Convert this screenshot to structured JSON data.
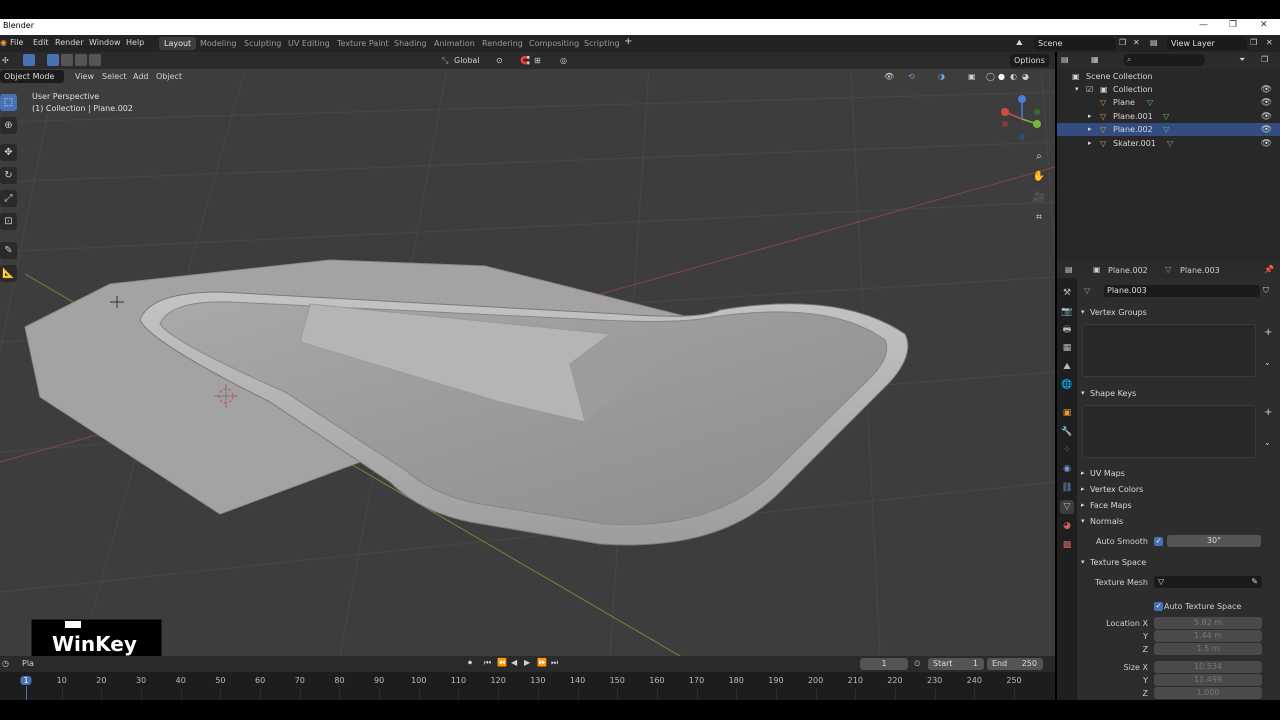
{
  "app": {
    "title": "Blender"
  },
  "menu": [
    "File",
    "Edit",
    "Render",
    "Window",
    "Help"
  ],
  "workspaces": [
    "Layout",
    "Modeling",
    "Sculpting",
    "UV Editing",
    "Texture Paint",
    "Shading",
    "Animation",
    "Rendering",
    "Compositing",
    "Scripting"
  ],
  "active_workspace": "Layout",
  "scene": {
    "name": "Scene",
    "view_layer": "View Layer"
  },
  "viewport_header": {
    "mode": "Object Mode",
    "view": "View",
    "select": "Select",
    "add": "Add",
    "object": "Object",
    "orientation": "Global",
    "options": "Options"
  },
  "viewport_overlay": {
    "perspective": "User Perspective",
    "collection_line": "(1) Collection | Plane.002"
  },
  "outliner": {
    "root": "Scene Collection",
    "collection": "Collection",
    "objects": [
      "Plane",
      "Plane.001",
      "Plane.002",
      "Skater.001"
    ]
  },
  "properties": {
    "object_name": "Plane.002",
    "mesh_name": "Plane.003",
    "datablock": "Plane.003",
    "panels": {
      "vertex_groups": "Vertex Groups",
      "shape_keys": "Shape Keys",
      "uv_maps": "UV Maps",
      "vertex_colors": "Vertex Colors",
      "face_maps": "Face Maps",
      "normals": "Normals",
      "texture_space": "Texture Space"
    },
    "auto_smooth_label": "Auto Smooth",
    "auto_smooth_angle": "30°",
    "texture_mesh_label": "Texture Mesh",
    "auto_texture_space": "Auto Texture Space",
    "location_label": "Location X",
    "location": {
      "x": "5.82 m",
      "y": "1.44 m",
      "z": "1.5 m"
    },
    "size_label": "Size X",
    "size": {
      "x": "10.534",
      "y": "11.499",
      "z": "1.000"
    },
    "axis_y": "Y",
    "axis_z": "Z"
  },
  "timeline": {
    "current_frame": "1",
    "start_label": "Start",
    "start": "1",
    "end_label": "End",
    "end": "250",
    "ruler": [
      "1",
      "10",
      "20",
      "30",
      "40",
      "50",
      "60",
      "70",
      "80",
      "90",
      "100",
      "110",
      "120",
      "130",
      "140",
      "150",
      "160",
      "170",
      "180",
      "190",
      "200",
      "210",
      "220",
      "230",
      "240",
      "250"
    ],
    "editor_label": "Pla"
  },
  "overlay_badge": {
    "text": "WinKey"
  },
  "colors": {
    "accent": "#4772b3",
    "viewport_bg": "#3d3d3d",
    "panel_bg": "#2d2d2d",
    "mesh_icon": "#66c466",
    "object_icon": "#e89a3c"
  }
}
